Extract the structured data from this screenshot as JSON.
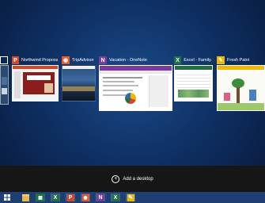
{
  "windows": [
    {
      "title": "",
      "app": "partial"
    },
    {
      "title": "Northwind Proposa...",
      "app": "PowerPoint",
      "icon": "powerpoint-icon",
      "color": "#d24726",
      "badge": "P"
    },
    {
      "title": "TripAdvisor",
      "app": "TripAdvisor",
      "icon": "tripadvisor-icon",
      "color": "#e85c2c",
      "badge": "◉"
    },
    {
      "title": "Vacation - OneNote",
      "app": "OneNote",
      "icon": "onenote-icon",
      "color": "#7b3c99",
      "badge": "N"
    },
    {
      "title": "Excel - Family...",
      "app": "Excel",
      "icon": "excel-icon",
      "color": "#1e7145",
      "badge": "X"
    },
    {
      "title": "Fresh Paint",
      "app": "Fresh Paint",
      "icon": "fresh-paint-icon",
      "color": "#f2b800",
      "badge": "✎"
    }
  ],
  "desktop_bar": {
    "add_label": "Add a desktop"
  },
  "taskbar": {
    "items": [
      {
        "name": "start-button",
        "icon": "windows-logo-icon",
        "color": "#1d3f73"
      },
      {
        "name": "file-explorer-button",
        "icon": "folder-icon",
        "color": "#e8b84a"
      },
      {
        "name": "store-button",
        "icon": "store-icon",
        "color": "#1e7145"
      },
      {
        "name": "excel-taskbar-button",
        "icon": "excel-icon",
        "color": "#1e7145"
      },
      {
        "name": "powerpoint-taskbar-button",
        "icon": "powerpoint-icon",
        "color": "#d24726"
      },
      {
        "name": "tripadvisor-taskbar-button",
        "icon": "tripadvisor-icon",
        "color": "#e85c2c"
      },
      {
        "name": "onenote-taskbar-button",
        "icon": "onenote-icon",
        "color": "#7b3c99"
      },
      {
        "name": "excel-taskbar-button-2",
        "icon": "excel-icon",
        "color": "#1e7145"
      },
      {
        "name": "fresh-paint-taskbar-button",
        "icon": "fresh-paint-icon",
        "color": "#f2b800"
      }
    ]
  }
}
